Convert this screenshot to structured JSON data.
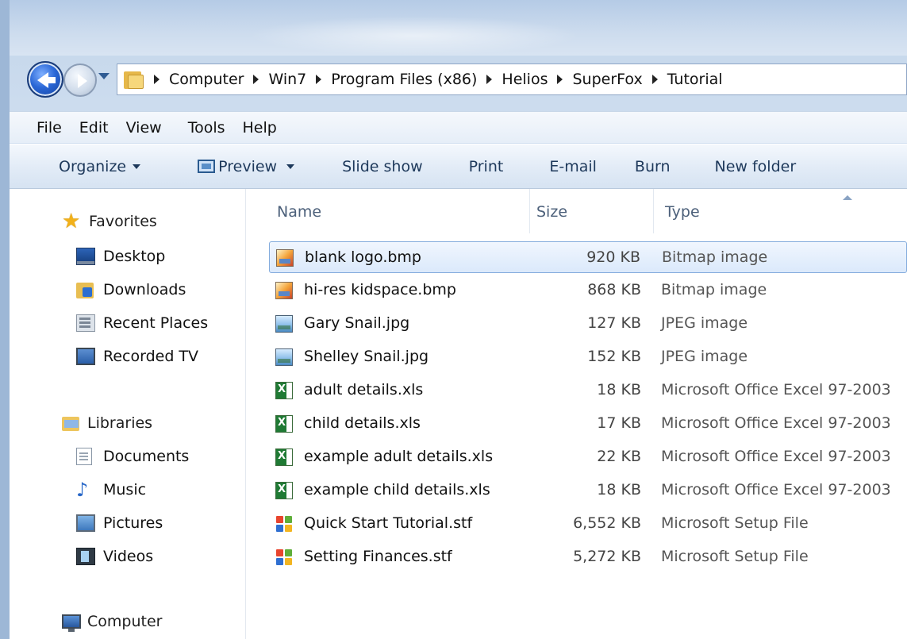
{
  "address": {
    "crumbs": [
      "Computer",
      "Win7",
      "Program Files (x86)",
      "Helios",
      "SuperFox",
      "Tutorial"
    ]
  },
  "menu": {
    "items": [
      "File",
      "Edit",
      "View",
      "Tools",
      "Help"
    ]
  },
  "toolbar": {
    "organize": "Organize",
    "preview": "Preview",
    "slideshow": "Slide show",
    "print": "Print",
    "email": "E-mail",
    "burn": "Burn",
    "new_folder": "New folder"
  },
  "nav": {
    "favorites": {
      "label": "Favorites",
      "items": [
        {
          "label": "Desktop",
          "icon": "desktop-icon"
        },
        {
          "label": "Downloads",
          "icon": "downloads-icon"
        },
        {
          "label": "Recent Places",
          "icon": "recent-places-icon"
        },
        {
          "label": "Recorded TV",
          "icon": "recorded-tv-icon"
        }
      ]
    },
    "libraries": {
      "label": "Libraries",
      "items": [
        {
          "label": "Documents",
          "icon": "documents-icon"
        },
        {
          "label": "Music",
          "icon": "music-icon"
        },
        {
          "label": "Pictures",
          "icon": "pictures-icon"
        },
        {
          "label": "Videos",
          "icon": "videos-icon"
        }
      ]
    },
    "computer": {
      "label": "Computer"
    }
  },
  "columns": {
    "name": "Name",
    "size": "Size",
    "type": "Type"
  },
  "files": [
    {
      "name": "blank logo.bmp",
      "size": "920 KB",
      "type": "Bitmap image",
      "icon": "bmp-icon",
      "selected": true
    },
    {
      "name": "hi-res kidspace.bmp",
      "size": "868 KB",
      "type": "Bitmap image",
      "icon": "bmp-icon"
    },
    {
      "name": "Gary Snail.jpg",
      "size": "127 KB",
      "type": "JPEG image",
      "icon": "jpg-icon"
    },
    {
      "name": "Shelley Snail.jpg",
      "size": "152 KB",
      "type": "JPEG image",
      "icon": "jpg-icon"
    },
    {
      "name": "adult details.xls",
      "size": "18 KB",
      "type": "Microsoft Office Excel 97-2003",
      "icon": "xls-icon"
    },
    {
      "name": "child details.xls",
      "size": "17 KB",
      "type": "Microsoft Office Excel 97-2003",
      "icon": "xls-icon"
    },
    {
      "name": "example adult details.xls",
      "size": "22 KB",
      "type": "Microsoft Office Excel 97-2003",
      "icon": "xls-icon"
    },
    {
      "name": "example child details.xls",
      "size": "18 KB",
      "type": "Microsoft Office Excel 97-2003",
      "icon": "xls-icon"
    },
    {
      "name": "Quick Start Tutorial.stf",
      "size": "6,552 KB",
      "type": "Microsoft Setup File",
      "icon": "stf-icon"
    },
    {
      "name": "Setting Finances.stf",
      "size": "5,272 KB",
      "type": "Microsoft Setup File",
      "icon": "stf-icon"
    }
  ]
}
